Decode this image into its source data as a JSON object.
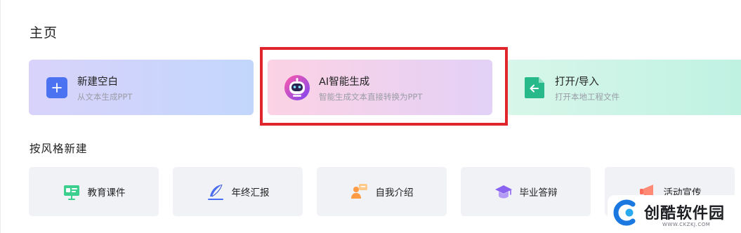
{
  "page": {
    "title": "主页"
  },
  "create_cards": [
    {
      "title": "新建空白",
      "subtitle": "从文本生成PPT",
      "icon": "plus-icon"
    },
    {
      "title": "AI智能生成",
      "subtitle": "智能生成文本直接转换为PPT",
      "icon": "robot-icon"
    },
    {
      "title": "打开/导入",
      "subtitle": "打开本地工程文件",
      "icon": "import-file-icon"
    }
  ],
  "style_section": {
    "title": "按风格新建",
    "items": [
      {
        "label": "教育课件",
        "icon": "presentation-board-icon"
      },
      {
        "label": "年终汇报",
        "icon": "feather-pen-icon"
      },
      {
        "label": "自我介绍",
        "icon": "person-card-icon"
      },
      {
        "label": "毕业答辩",
        "icon": "graduation-cap-icon"
      },
      {
        "label": "活动宣传",
        "icon": "megaphone-icon"
      }
    ]
  },
  "watermark": {
    "name": "创酷软件园",
    "url": "WWW.CKZKJ.COM"
  },
  "colors": {
    "highlight_frame": "#e0262c",
    "plus_icon_bg": "#4a72f1",
    "import_icon_bg": "#27b98a"
  }
}
